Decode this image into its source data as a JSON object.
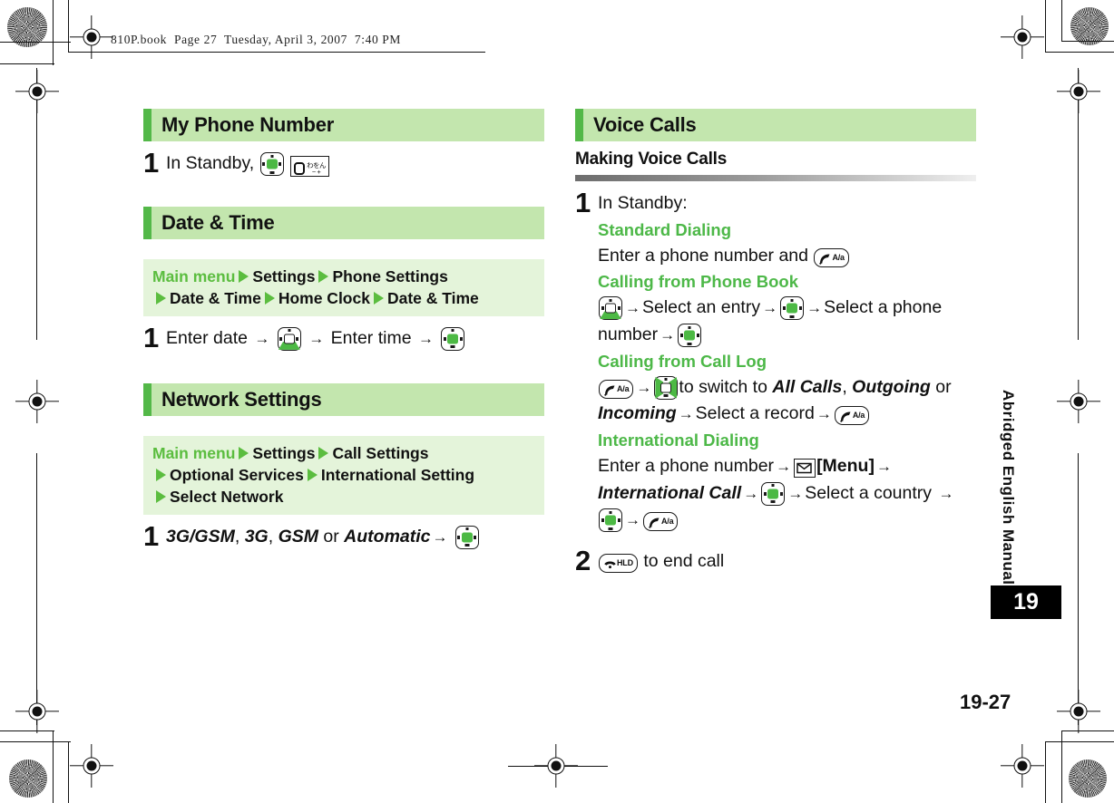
{
  "document": {
    "filestamp": "810P.book  Page 27  Tuesday, April 3, 2007  7:40 PM",
    "page_number": "19-27",
    "chapter_tag": "19",
    "side_text": "Abridged English Manual"
  },
  "left_column": {
    "sections": [
      {
        "title": "My Phone Number",
        "steps": [
          {
            "num": "1",
            "text_before": "In Standby,",
            "keys": [
              "center-select-key",
              "kana-wa-wo-n-key"
            ]
          }
        ]
      },
      {
        "title": "Date & Time",
        "breadcrumb": {
          "root": "Main menu",
          "items": [
            "Settings",
            "Phone Settings",
            "Date & Time",
            "Home Clock",
            "Date & Time"
          ]
        },
        "steps": [
          {
            "num": "1",
            "seg1": "Enter date",
            "seg2": "Enter time",
            "arrow": "→"
          }
        ]
      },
      {
        "title": "Network Settings",
        "breadcrumb": {
          "root": "Main menu",
          "items": [
            "Settings",
            "Call Settings",
            "Optional Services",
            "International Setting",
            "Select Network"
          ]
        },
        "steps": [
          {
            "num": "1",
            "opt1": "3G/GSM",
            "opt2": "3G",
            "opt3": "GSM",
            "conj": "or",
            "opt4": "Automatic",
            "arrow": "→"
          }
        ]
      }
    ]
  },
  "right_column": {
    "section_title": "Voice Calls",
    "subheading": "Making Voice Calls",
    "steps": [
      {
        "num": "1",
        "intro": "In Standby:",
        "groups": [
          {
            "heading": "Standard Dialing",
            "text": "Enter a phone number and"
          },
          {
            "heading": "Calling from Phone Book",
            "t1": "Select an entry",
            "t2": "Select a phone",
            "t3": "number"
          },
          {
            "heading": "Calling from Call Log",
            "t1": "to switch to",
            "v1": "All Calls",
            "comma": ",",
            "v2": "Outgoing",
            "conj": "or",
            "v3": "Incoming",
            "t2": "Select a record"
          },
          {
            "heading": "International Dialing",
            "t1": "Enter a phone number",
            "menu": "[Menu]",
            "v1": "International Call",
            "t2": "Select a country"
          }
        ]
      },
      {
        "num": "2",
        "text": "to end call"
      }
    ]
  },
  "icons": {
    "arrow": "→",
    "kana_label": "わをん",
    "plus_minus": "− +",
    "call_key_label": "A/a",
    "end_key_label": "HLD"
  },
  "colors": {
    "banner_bg": "#c3e6ae",
    "banner_bar": "#53b848",
    "crumb_bg": "#e4f4da",
    "green_text": "#4db848",
    "green_tri": "#5bbd3f",
    "key_green": "#4cb944"
  }
}
